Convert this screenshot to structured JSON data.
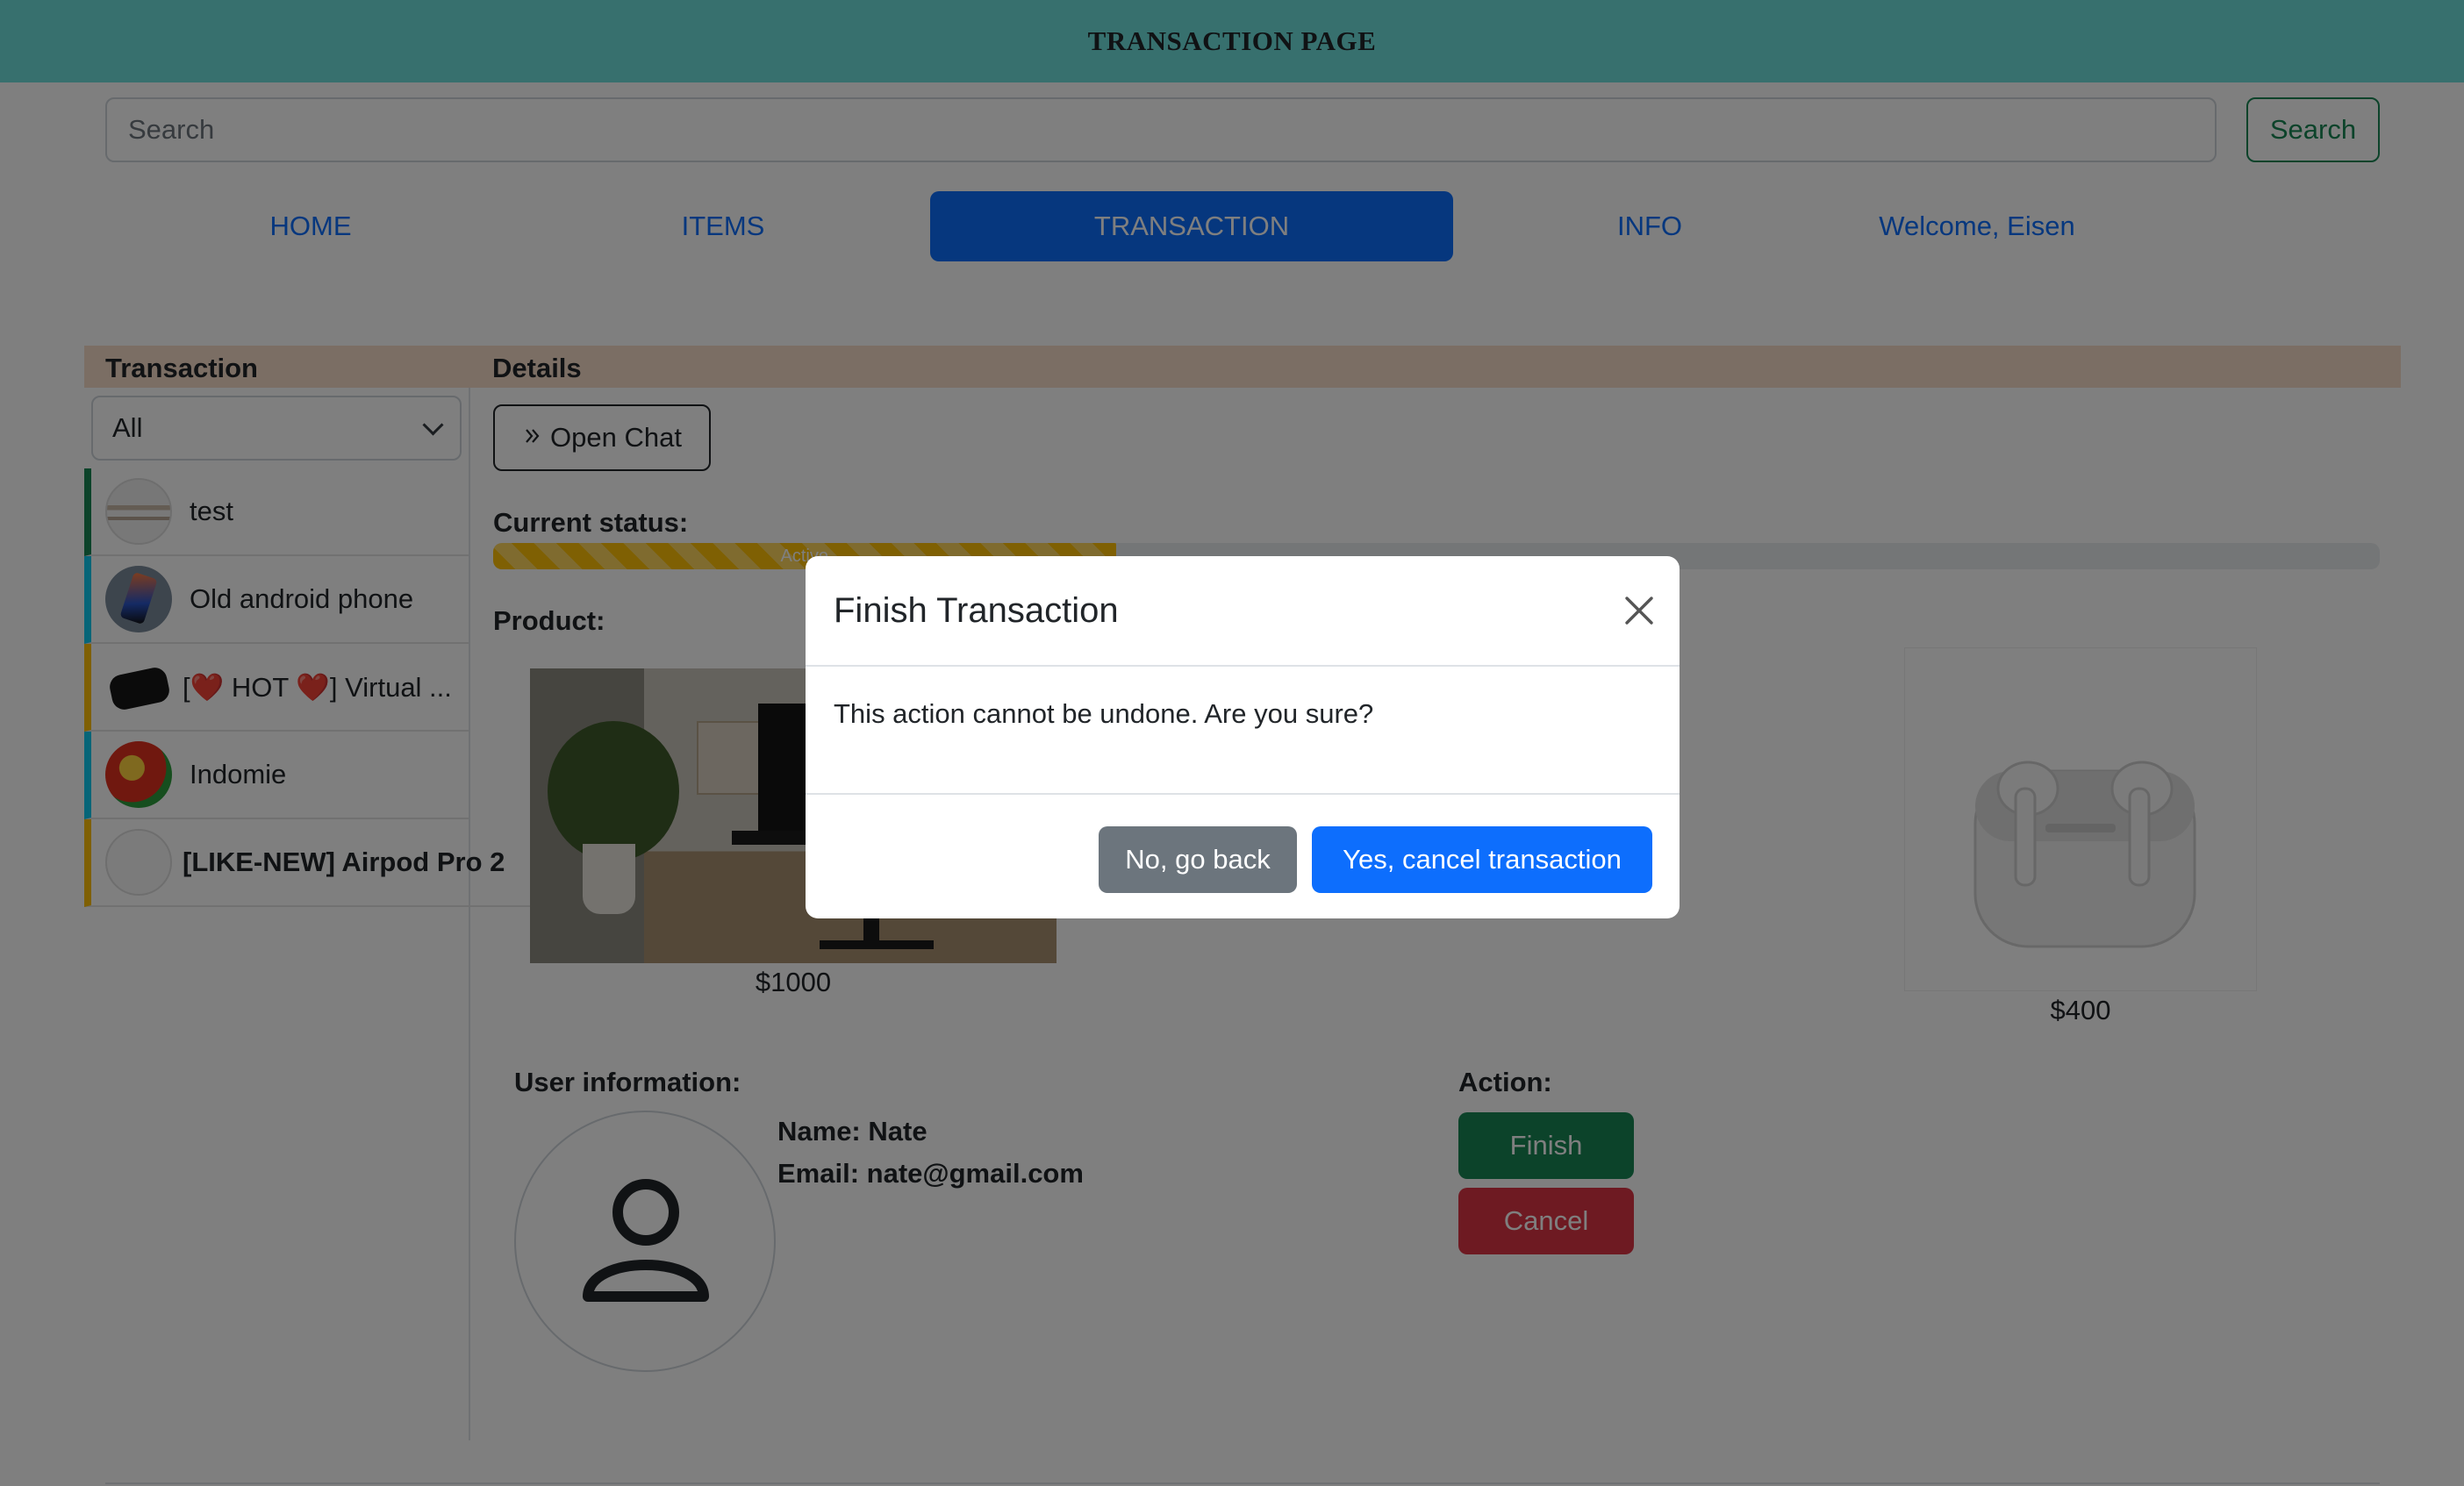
{
  "header": {
    "title": "TRANSACTION PAGE"
  },
  "search": {
    "placeholder": "Search",
    "button_label": "Search"
  },
  "nav": {
    "home": "HOME",
    "items": "ITEMS",
    "transaction": "TRANSACTION",
    "info": "INFO",
    "welcome": "Welcome, Eisen"
  },
  "transaction_panel": {
    "header_left": "Transaction",
    "header_right": "Details",
    "filter": {
      "selected": "All"
    },
    "items": [
      {
        "label": "test",
        "status_color": "#198754"
      },
      {
        "label": "Old android phone",
        "status_color": "#0dcaf0"
      },
      {
        "label": "[❤️ HOT ❤️] Virtual ...",
        "status_color": "#ffc107"
      },
      {
        "label": "Indomie",
        "status_color": "#0dcaf0"
      },
      {
        "label": "[LIKE-NEW] Airpod Pro 2",
        "status_color": "#ffc107"
      }
    ]
  },
  "details": {
    "open_chat_label": "Open Chat",
    "current_status_label": "Current status:",
    "progress": {
      "label": "Active",
      "percent": 33
    },
    "product_label": "Product:",
    "products": [
      {
        "price": "$1000"
      },
      {
        "price": "$400"
      }
    ],
    "user_info_label": "User information:",
    "user": {
      "name": "Name: Nate",
      "email": "Email: nate@gmail.com"
    },
    "action_label": "Action:",
    "finish_label": "Finish",
    "cancel_label": "Cancel"
  },
  "modal": {
    "title": "Finish Transaction",
    "body": "This action cannot be undone. Are you sure?",
    "back_label": "No, go back",
    "confirm_label": "Yes, cancel transaction"
  },
  "colors": {
    "header_bg": "#6ee0dc",
    "primary": "#0d6efd",
    "success": "#198754",
    "danger": "#dc3545",
    "secondary": "#6c757d",
    "warning": "#ffc107"
  }
}
